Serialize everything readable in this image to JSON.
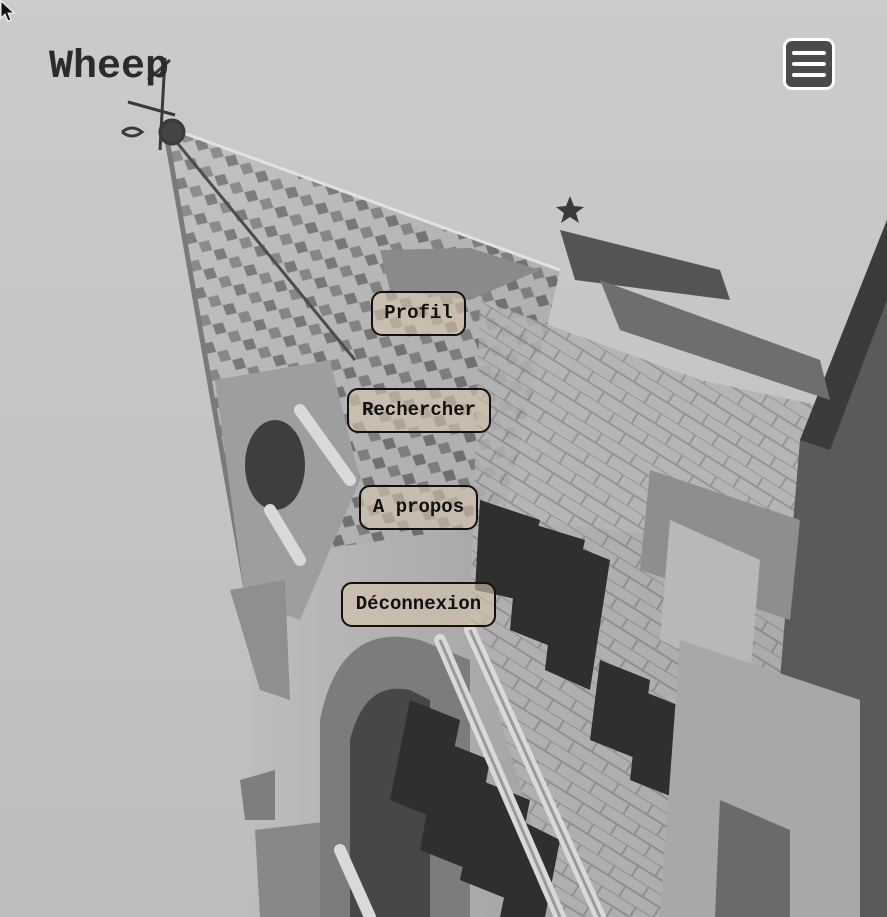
{
  "header": {
    "brand": "Wheep",
    "menu_icon": "hamburger-menu-icon"
  },
  "nav": {
    "items": [
      {
        "label": "Profil"
      },
      {
        "label": "Rechercher"
      },
      {
        "label": "A propos"
      },
      {
        "label": "Déconnexion"
      }
    ]
  },
  "background": {
    "subject": "cathedral-spire-photo",
    "sky_color": "#c4c4c4"
  }
}
